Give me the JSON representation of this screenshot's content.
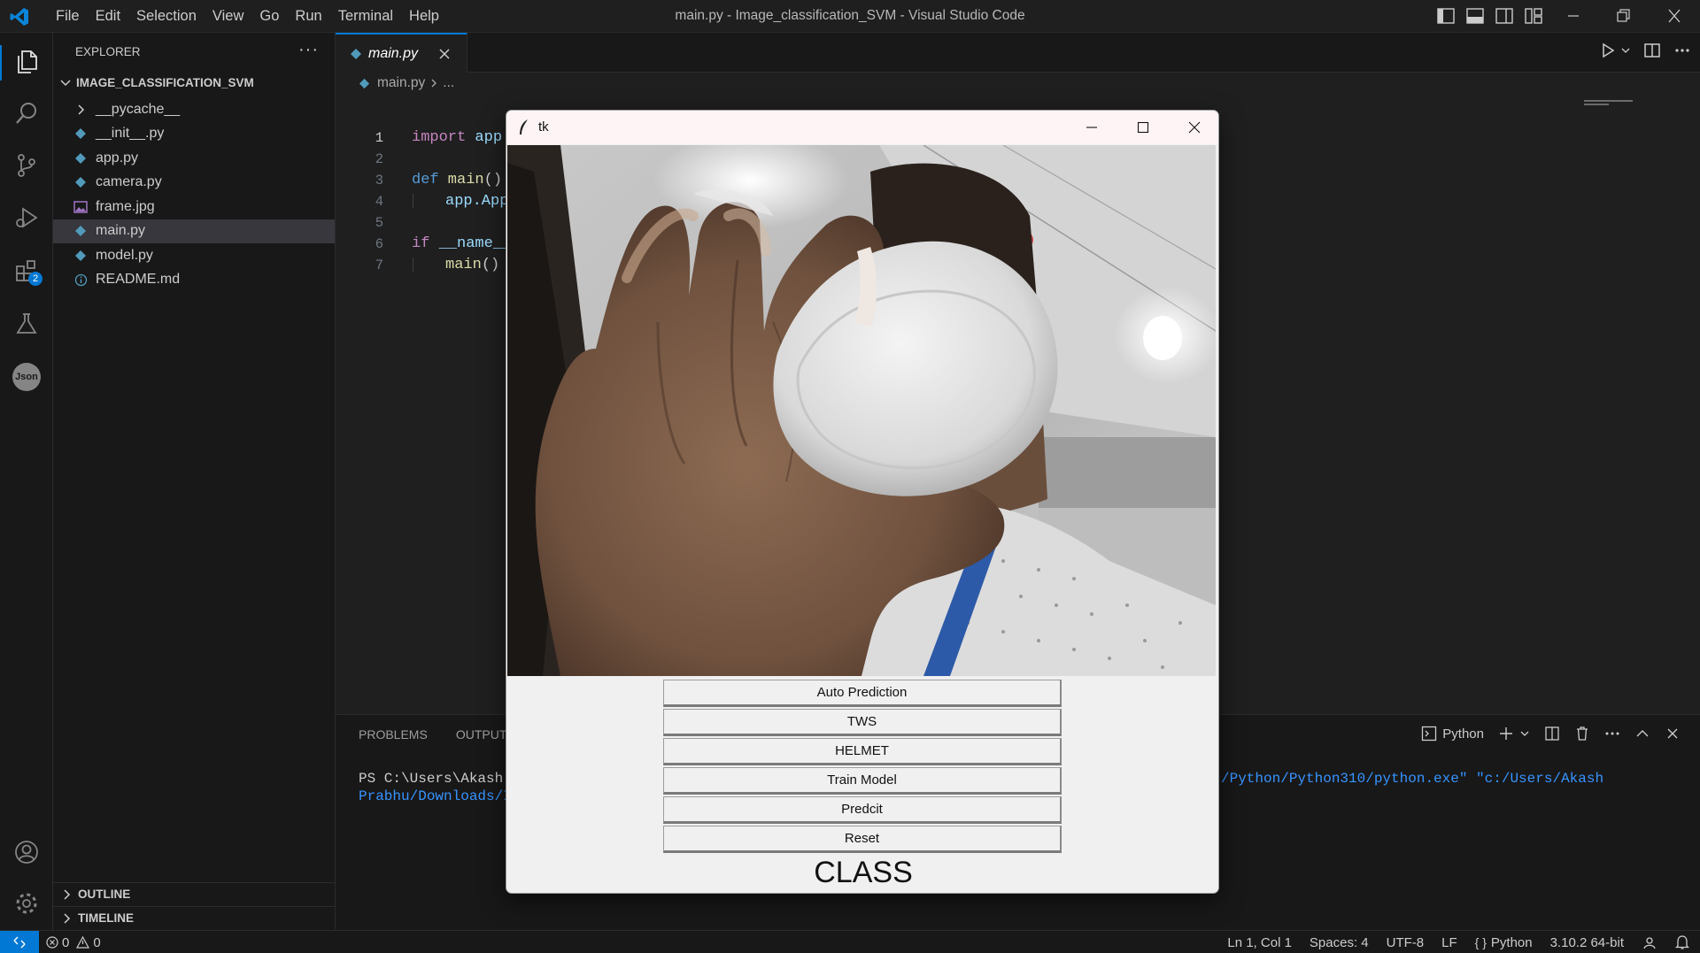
{
  "titlebar": {
    "menu": [
      "File",
      "Edit",
      "Selection",
      "View",
      "Go",
      "Run",
      "Terminal",
      "Help"
    ],
    "title": "main.py - Image_classification_SVM - Visual Studio Code"
  },
  "activity_bar": {
    "items": [
      "explorer-icon",
      "search-icon",
      "source-control-icon",
      "run-debug-icon",
      "extensions-icon",
      "testing-icon",
      "json-icon"
    ],
    "extensions_badge": "2",
    "json_label": "Json"
  },
  "explorer": {
    "header": "EXPLORER",
    "more": "···",
    "root": "IMAGE_CLASSIFICATION_SVM",
    "items": [
      {
        "label": "__pycache__",
        "kind": "folder"
      },
      {
        "label": "__init__.py",
        "kind": "python"
      },
      {
        "label": "app.py",
        "kind": "python"
      },
      {
        "label": "camera.py",
        "kind": "python"
      },
      {
        "label": "frame.jpg",
        "kind": "image"
      },
      {
        "label": "main.py",
        "kind": "python",
        "selected": true
      },
      {
        "label": "model.py",
        "kind": "python"
      },
      {
        "label": "README.md",
        "kind": "info"
      }
    ],
    "outline": "OUTLINE",
    "timeline": "TIMELINE"
  },
  "editor": {
    "tab_label": "main.py",
    "breadcrumb_file": "main.py",
    "breadcrumb_more": "...",
    "lines": [
      "1",
      "2",
      "3",
      "4",
      "5",
      "6",
      "7"
    ],
    "code": {
      "l1_kw": "import",
      "l1_rest": " app",
      "l3_kw": "def",
      "l3_fn": " main",
      "l3_rest": "():",
      "l4_obj": "app",
      "l4_rest": ".App",
      "l6_kw": "if",
      "l6_rest": " __name__",
      "l7_fn": "main",
      "l7_rest": "()"
    }
  },
  "panel": {
    "tabs": [
      "PROBLEMS",
      "OUTPUT"
    ],
    "terminal_label": "Python",
    "terminal_line1_prefix": "PS C:\\Users\\Akash P",
    "terminal_line1_path": "/Python/Python310/python.exe\" \"c:/Users/Akash",
    "terminal_line2": "Prabhu/Downloads/I"
  },
  "statusbar": {
    "errors": "0",
    "warnings": "0",
    "cursor": "Ln 1, Col 1",
    "spaces": "Spaces: 4",
    "encoding": "UTF-8",
    "eol": "LF",
    "language": "Python",
    "interpreter": "3.10.2 64-bit"
  },
  "tk_window": {
    "title": "tk",
    "buttons": [
      "Auto Prediction",
      "TWS",
      "HELMET",
      "Train Model",
      "Predcit",
      "Reset"
    ],
    "class_label": "CLASS"
  },
  "colors": {
    "accent": "#0078d4",
    "editor_bg": "#1f1f1f",
    "sidebar_bg": "#181818",
    "python_icon": "#519aba"
  }
}
